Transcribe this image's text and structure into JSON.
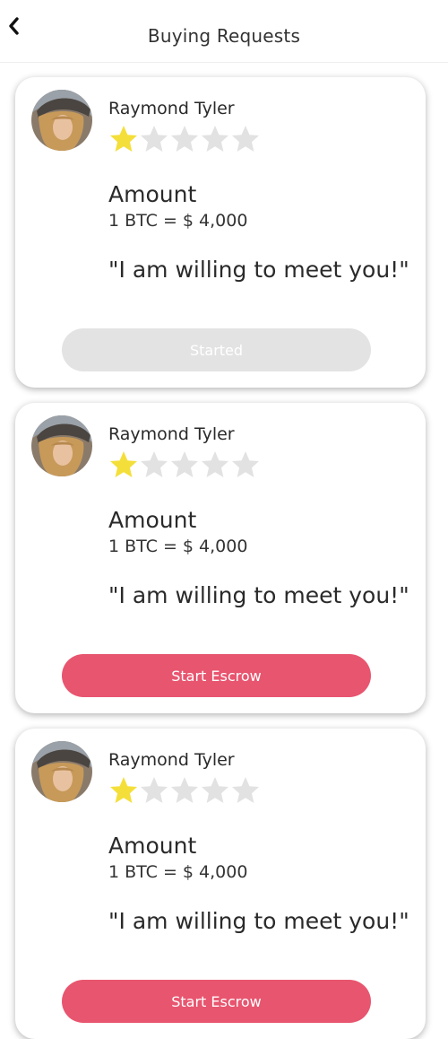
{
  "header": {
    "title": "Buying Requests",
    "back_icon": "chevron-left-icon"
  },
  "colors": {
    "accent": "#e8556f",
    "disabled": "#e3e3e3",
    "star_filled": "#f4df3a",
    "star_empty": "#e2e2e2"
  },
  "requests": [
    {
      "name": "Raymond Tyler",
      "rating": 1,
      "rating_max": 5,
      "amount_label": "Amount",
      "amount_value": "1 BTC = $ 4,000",
      "message": "\"I am willing to meet you!\"",
      "button_label": "Started",
      "button_state": "disabled"
    },
    {
      "name": "Raymond Tyler",
      "rating": 1,
      "rating_max": 5,
      "amount_label": "Amount",
      "amount_value": "1 BTC = $ 4,000",
      "message": "\"I am willing to meet you!\"",
      "button_label": "Start Escrow",
      "button_state": "active"
    },
    {
      "name": "Raymond Tyler",
      "rating": 1,
      "rating_max": 5,
      "amount_label": "Amount",
      "amount_value": "1 BTC = $ 4,000",
      "message": "\"I am willing to meet you!\"",
      "button_label": "Start Escrow",
      "button_state": "active"
    }
  ]
}
